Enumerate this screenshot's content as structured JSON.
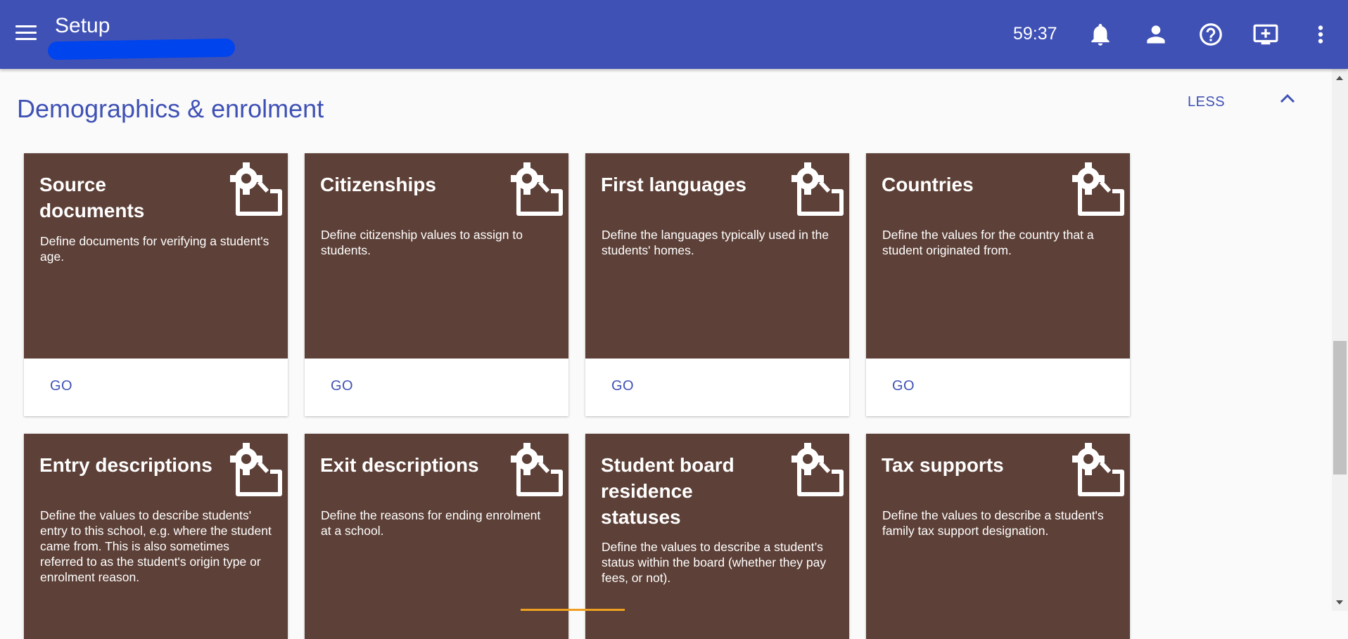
{
  "app": {
    "title": "Setup",
    "timer": "59:37",
    "icons": {
      "menu": "menu-icon",
      "notifications": "bell-icon",
      "account": "person-icon",
      "help": "help-icon",
      "screen": "monitor-icon",
      "more": "more-vert-icon"
    },
    "colors": {
      "primary": "#3f51b5",
      "card": "#5d4037"
    }
  },
  "section": {
    "title": "Demographics & enrolment",
    "toggle_label": "LESS"
  },
  "cards": [
    {
      "title": "Source documents",
      "description": "Define documents for verifying a student's age.",
      "action": "GO"
    },
    {
      "title": "Citizenships",
      "description": "Define citizenship values to assign to students.",
      "action": "GO"
    },
    {
      "title": "First languages",
      "description": "Define the languages typically used in the students' homes.",
      "action": "GO"
    },
    {
      "title": "Countries",
      "description": "Define the values for the country that a student originated from.",
      "action": "GO"
    },
    {
      "title": "Entry descriptions",
      "description": "Define the values to describe students' entry to this school, e.g. where the student came from. This is also sometimes referred to as the student's origin type or enrolment reason."
    },
    {
      "title": "Exit descriptions",
      "description": "Define the reasons for ending enrolment at a school."
    },
    {
      "title": "Student board residence statuses",
      "description": "Define the values to describe a student’s status within the board (whether they pay fees, or not)."
    },
    {
      "title": "Tax supports",
      "description": "Define the values to describe a student's family tax support designation."
    }
  ]
}
